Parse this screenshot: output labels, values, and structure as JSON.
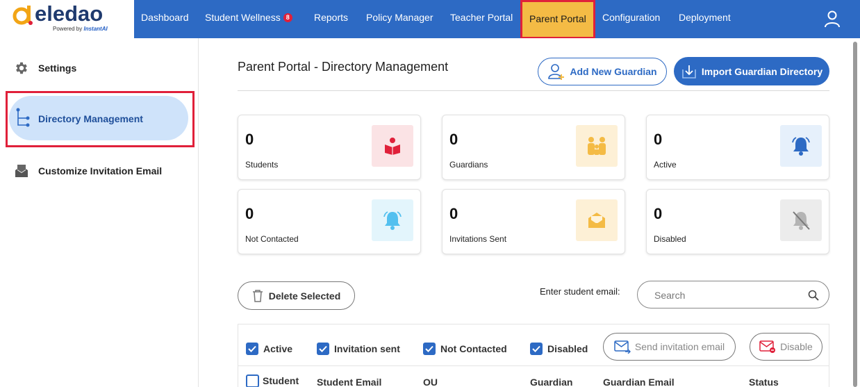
{
  "brand": {
    "name": "eledao",
    "powered_by": "Powered by",
    "powered_by_brand": "InstantAI",
    "colors": {
      "primary": "#2d6ac4",
      "accent_active": "#f4bb45",
      "highlight": "#e0203a",
      "logo_orange": "#f2a516"
    }
  },
  "nav": {
    "items": [
      {
        "label": "Dashboard"
      },
      {
        "label": "Student Wellness",
        "badge": "8"
      },
      {
        "label": "Reports"
      },
      {
        "label": "Policy Manager"
      },
      {
        "label": "Teacher Portal"
      },
      {
        "label": "Parent Portal",
        "active": true
      },
      {
        "label": "Configuration"
      },
      {
        "label": "Deployment"
      }
    ],
    "user_icon": "user-icon"
  },
  "sidebar": {
    "items": [
      {
        "label": "Settings",
        "icon": "gear-icon"
      },
      {
        "label": "Directory Management",
        "icon": "tree-icon",
        "active": true
      },
      {
        "label": "Customize Invitation Email",
        "icon": "mail-tray-icon"
      }
    ]
  },
  "main": {
    "title": "Parent Portal - Directory Management",
    "add_guardian_label": "Add New Guardian",
    "import_label": "Import Guardian Directory",
    "stats": [
      {
        "value": "0",
        "label": "Students",
        "icon": "reading-student-icon",
        "color": "#e0203a",
        "bg": "#fbe3e5"
      },
      {
        "value": "0",
        "label": "Guardians",
        "icon": "family-icon",
        "color": "#f4bb45",
        "bg": "#fdf0d6"
      },
      {
        "value": "0",
        "label": "Active",
        "icon": "bell-icon",
        "color": "#2d6ac4",
        "bg": "#e6f0fb"
      },
      {
        "value": "0",
        "label": "Not Contacted",
        "icon": "bell-icon",
        "color": "#53c0ef",
        "bg": "#e3f5fc"
      },
      {
        "value": "0",
        "label": "Invitations Sent",
        "icon": "envelope-open-icon",
        "color": "#f4bb45",
        "bg": "#fdf0d6"
      },
      {
        "value": "0",
        "label": "Disabled",
        "icon": "bell-off-icon",
        "color": "#9a9a9a",
        "bg": "#ececec"
      }
    ],
    "delete_label": "Delete Selected",
    "search_label": "Enter student email:",
    "search_placeholder": "Search",
    "filters": [
      {
        "label": "Active",
        "checked": true
      },
      {
        "label": "Invitation sent",
        "checked": true
      },
      {
        "label": "Not Contacted",
        "checked": true
      },
      {
        "label": "Disabled",
        "checked": true
      }
    ],
    "send_invitation_label": "Send invitation email",
    "disable_label": "Disable",
    "columns": [
      "Student",
      "Student Email",
      "OU",
      "Guardian",
      "Guardian Email",
      "Status"
    ]
  }
}
